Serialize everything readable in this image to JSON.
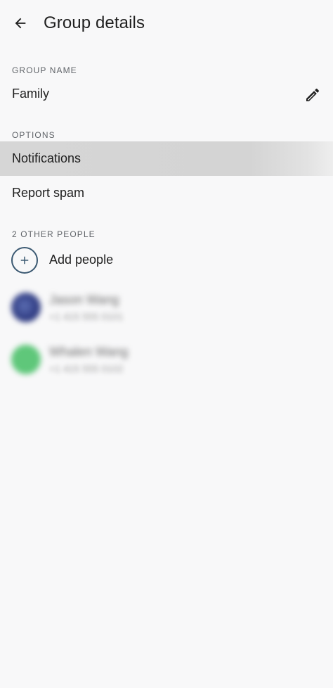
{
  "header": {
    "title": "Group details",
    "back_icon": "arrow-left-icon"
  },
  "group_name": {
    "label": "GROUP NAME",
    "value": "Family",
    "edit_icon": "pencil-icon"
  },
  "options": {
    "label": "OPTIONS",
    "items": [
      {
        "label": "Notifications",
        "highlighted": true
      },
      {
        "label": "Report spam",
        "highlighted": false
      }
    ]
  },
  "people": {
    "label": "2 OTHER PEOPLE",
    "add_label": "Add people",
    "add_icon": "plus-circle-icon",
    "members": [
      {
        "name": "Jason Wang",
        "subtitle": "+1 415 555 0101",
        "avatar_color": "#3a4a8f"
      },
      {
        "name": "Whalen Wang",
        "subtitle": "+1 415 555 0102",
        "avatar_color": "#5fc77a"
      }
    ]
  },
  "colors": {
    "background": "#f8f8f9",
    "highlight_row": "#d6d6d6",
    "add_circle_border": "#3c5a73"
  }
}
